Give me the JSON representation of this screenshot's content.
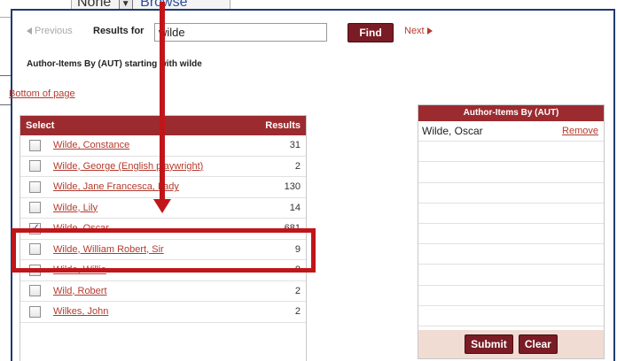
{
  "background": {
    "select_value": "None",
    "browse_label": "Browse"
  },
  "nav": {
    "previous_label": "Previous",
    "results_for_label": "Results for",
    "search_value": "wilde",
    "find_label": "Find",
    "next_label": "Next"
  },
  "subheading": "Author-Items By (AUT) starting with wilde",
  "bottom_link": "Bottom of page",
  "results": {
    "header_select": "Select",
    "header_results": "Results",
    "rows": [
      {
        "name": "Wilde, Constance",
        "count": "31",
        "checked": false
      },
      {
        "name": "Wilde, George (English playwright)",
        "count": "2",
        "checked": false
      },
      {
        "name": "Wilde, Jane Francesca, Lady",
        "count": "130",
        "checked": false
      },
      {
        "name": "Wilde, Lily",
        "count": "14",
        "checked": false
      },
      {
        "name": "Wilde, Oscar",
        "count": "681",
        "checked": true
      },
      {
        "name": "Wilde, William Robert, Sir",
        "count": "9",
        "checked": false
      },
      {
        "name": "Wilde, Willie",
        "count": "8",
        "checked": false
      },
      {
        "name": "Wild, Robert",
        "count": "2",
        "checked": false
      },
      {
        "name": "Wilkes, John",
        "count": "2",
        "checked": false
      }
    ]
  },
  "selected": {
    "header": "Author-Items By (AUT)",
    "items": [
      {
        "name": "Wilde, Oscar",
        "remove_label": "Remove"
      }
    ],
    "submit_label": "Submit",
    "clear_label": "Clear"
  },
  "colors": {
    "accent": "#9c2b2f",
    "button": "#7a1c25",
    "link": "#b33b2e",
    "annotation": "#c0161a",
    "frame": "#1f3a6e"
  }
}
